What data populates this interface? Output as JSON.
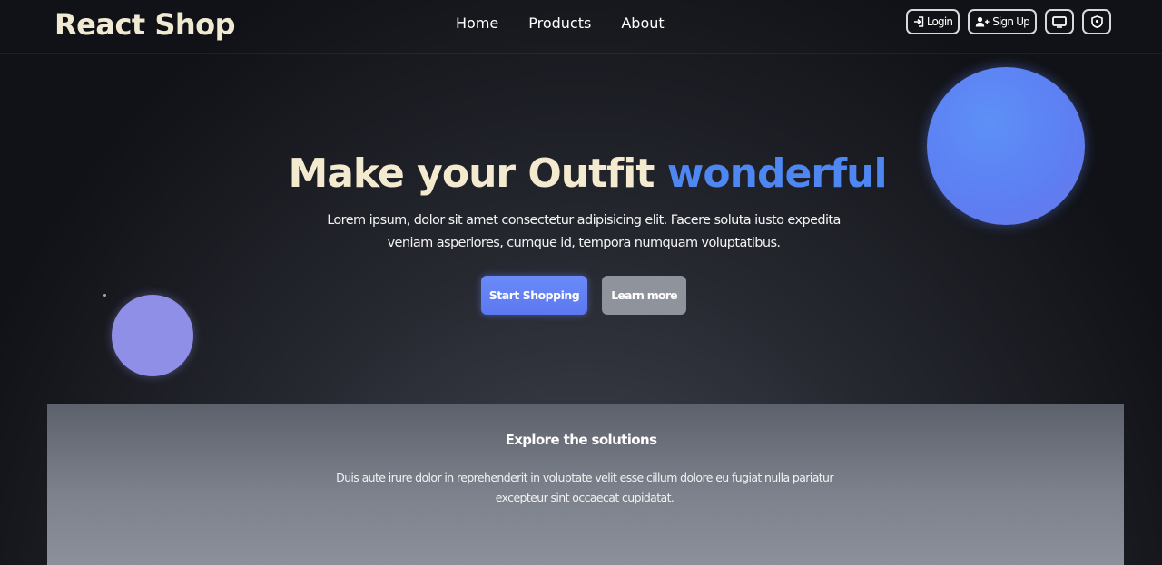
{
  "brand": "React Shop",
  "nav": {
    "links": [
      "Home",
      "Products",
      "About"
    ]
  },
  "auth": {
    "login_label": "Login",
    "signup_label": "Sign Up",
    "icons": [
      "login-icon",
      "user-plus-icon",
      "monitor-icon",
      "shield-icon"
    ]
  },
  "hero": {
    "title_main": "Make your Outfit",
    "title_accent": "wonderful",
    "description": "Lorem ipsum, dolor sit amet consectetur adipisicing elit. Facere soluta iusto expedita veniam asperiores, cumque id, tempora numquam voluptatibus.",
    "primary_button": "Start Shopping",
    "secondary_button": "Learn more"
  },
  "section": {
    "title": "Explore the solutions",
    "text": "Duis aute irure dolor in reprehenderit in voluptate velit esse cillum dolore eu fugiat nulla pariatur excepteur sint occaecat cupidatat."
  },
  "colors": {
    "accent": "#4e86f2",
    "brand_text": "#f1ead2",
    "primary_button": "#6b8bf8",
    "secondary_button": "#8e939c"
  }
}
